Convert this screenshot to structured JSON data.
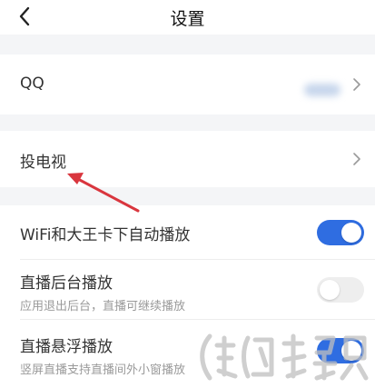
{
  "header": {
    "title": "设置"
  },
  "rows": {
    "qq": {
      "label": "QQ"
    },
    "cast": {
      "label": "投电视"
    },
    "wifi_autoplay": {
      "label": "WiFi和大王卡下自动播放",
      "enabled": true
    },
    "live_background": {
      "label": "直播后台播放",
      "sub": "应用退出后台，直播可继续播放",
      "enabled": false
    },
    "live_float": {
      "label": "直播悬浮播放",
      "sub": "竖屏直播支持直播间外小窗播放",
      "enabled": true
    }
  },
  "colors": {
    "accent": "#2f6de1",
    "arrow": "#d9363e"
  },
  "icons": {
    "back": "back-arrow-icon",
    "chevron": "chevron-right-icon"
  }
}
